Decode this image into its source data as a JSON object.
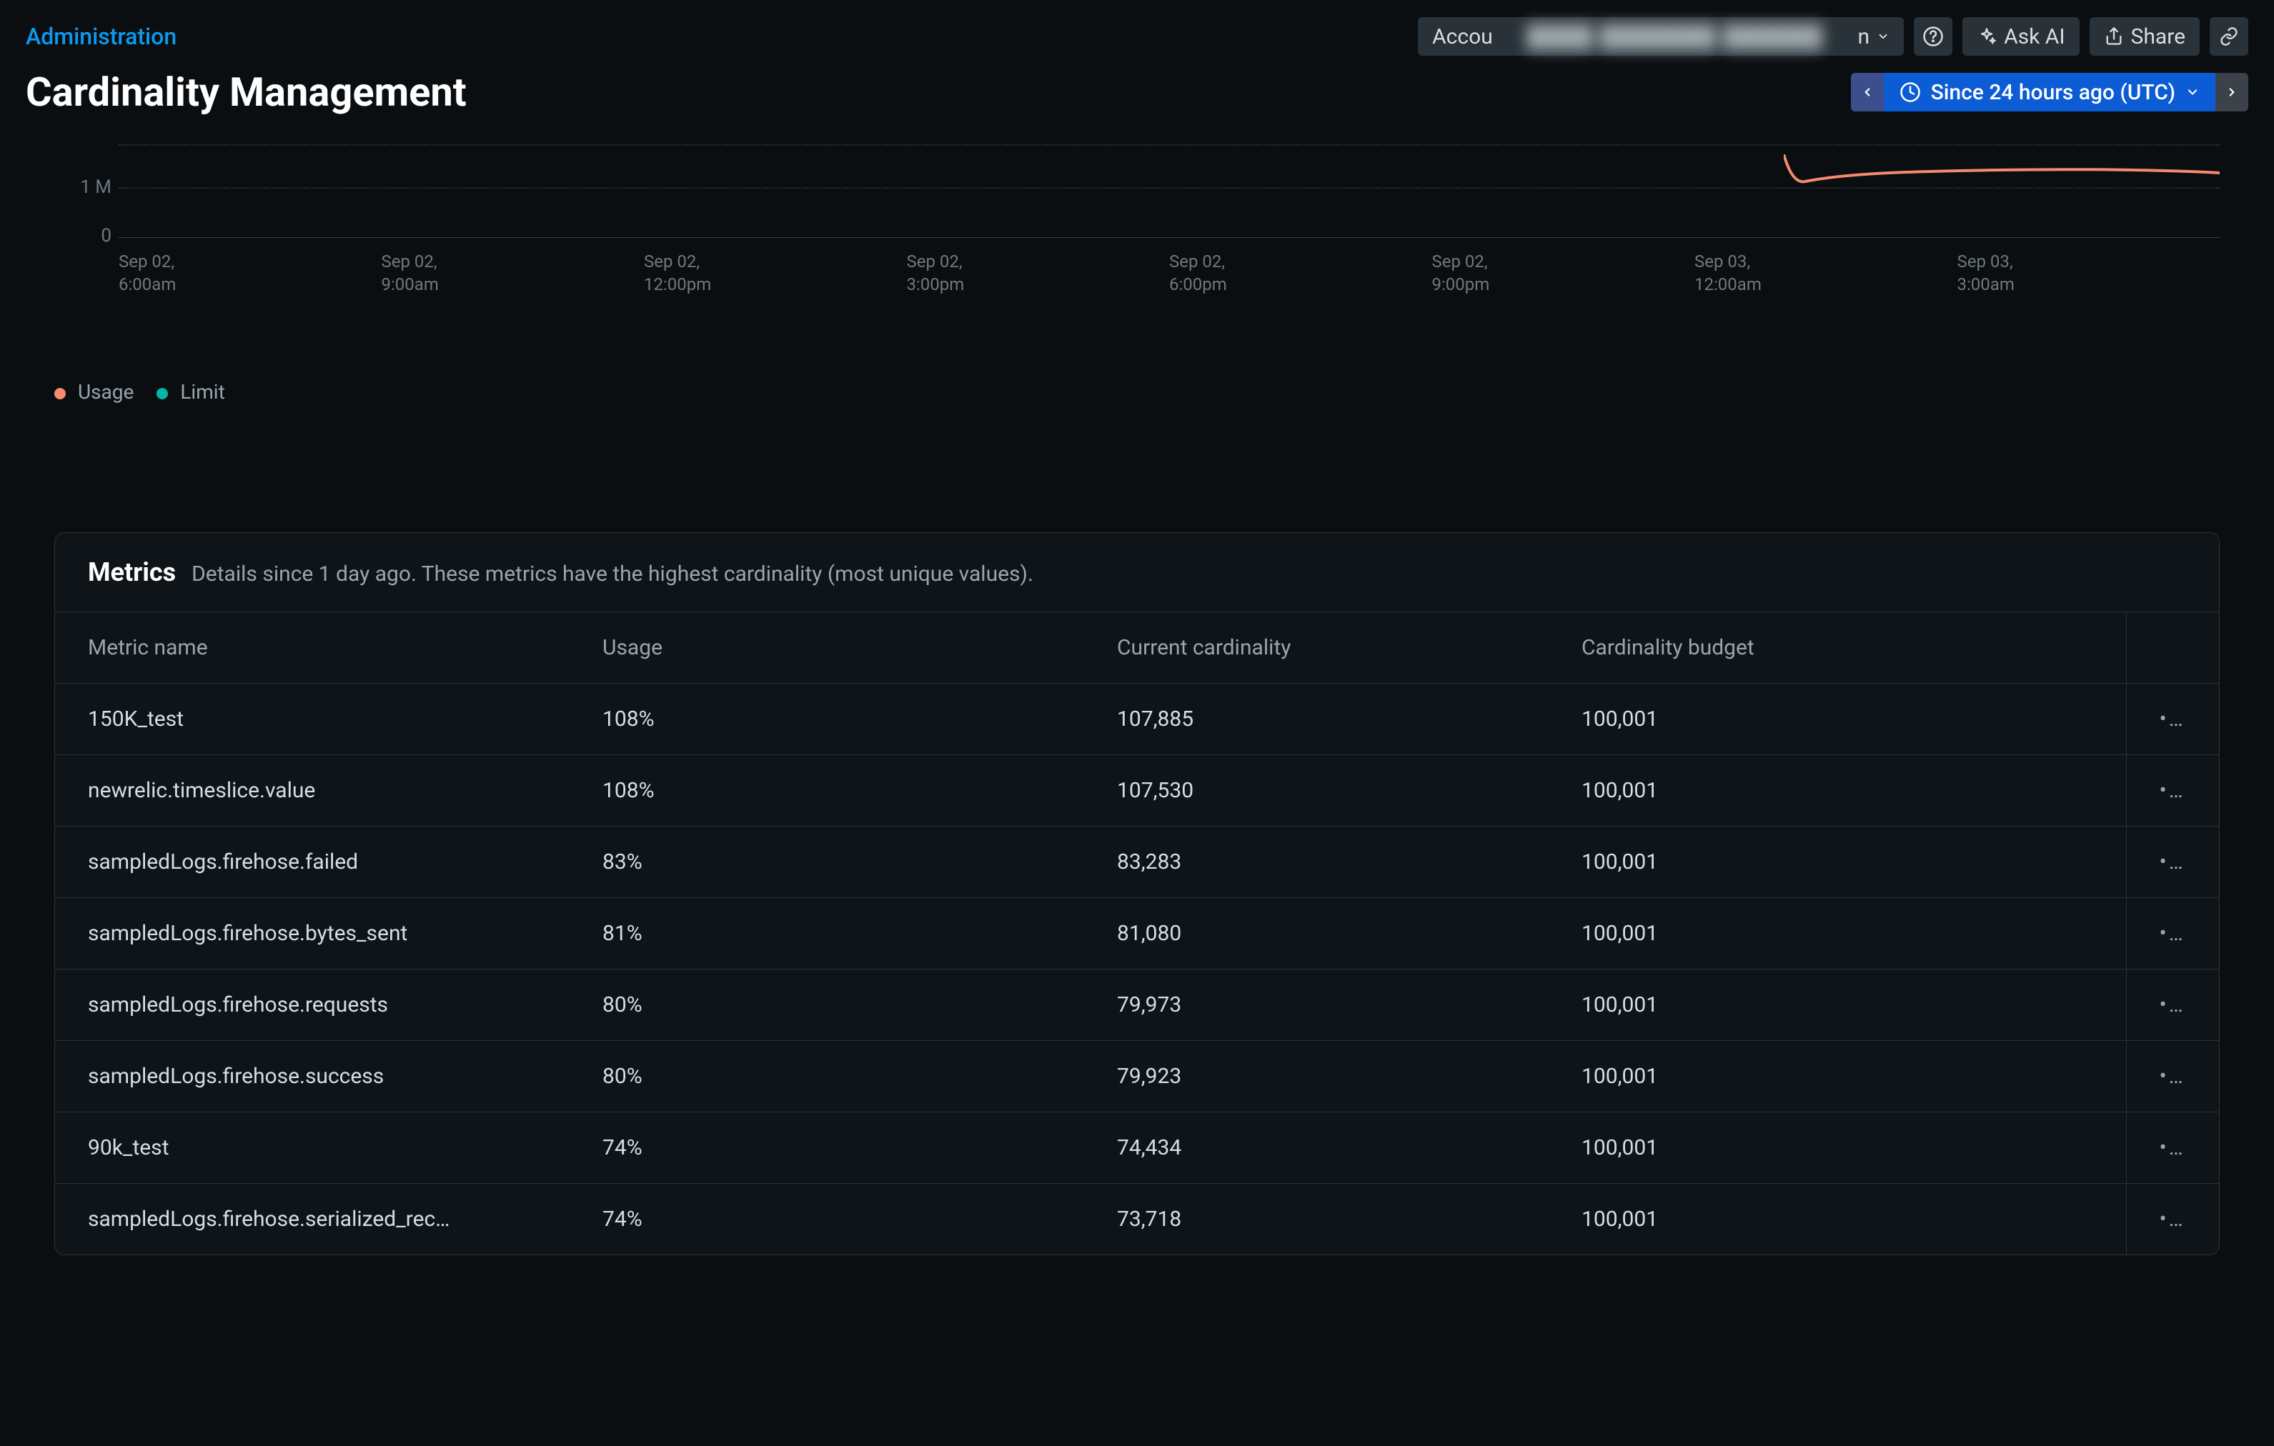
{
  "breadcrumb": "Administration",
  "page_title": "Cardinality Management",
  "header": {
    "account_prefix": "Accou",
    "account_blur": "n",
    "ask_ai": "Ask AI",
    "share": "Share"
  },
  "time_picker": {
    "label": "Since 24 hours ago (UTC)"
  },
  "chart_data": {
    "type": "line",
    "ylabels": [
      "1 M",
      "0"
    ],
    "xlabels": [
      "Sep 02,\n6:00am",
      "Sep 02,\n9:00am",
      "Sep 02,\n12:00pm",
      "Sep 02,\n3:00pm",
      "Sep 02,\n6:00pm",
      "Sep 02,\n9:00pm",
      "Sep 03,\n12:00am",
      "Sep 03,\n3:00am"
    ],
    "series": [
      {
        "name": "Usage",
        "color": "#f58a6e",
        "values_approx": [
          1700000,
          1500000,
          1540000,
          1560000,
          1570000,
          1570000,
          1560000
        ]
      }
    ],
    "ylim": [
      0,
      2000000
    ],
    "legend": [
      "Usage",
      "Limit"
    ]
  },
  "metrics_panel": {
    "title": "Metrics",
    "subtitle": "Details since 1 day ago. These metrics have the highest cardinality (most unique values).",
    "columns": [
      "Metric name",
      "Usage",
      "Current cardinality",
      "Cardinality budget"
    ],
    "rows": [
      {
        "name": "150K_test",
        "usage": "108%",
        "current": "107,885",
        "budget": "100,001"
      },
      {
        "name": "newrelic.timeslice.value",
        "usage": "108%",
        "current": "107,530",
        "budget": "100,001"
      },
      {
        "name": "sampledLogs.firehose.failed",
        "usage": "83%",
        "current": "83,283",
        "budget": "100,001"
      },
      {
        "name": "sampledLogs.firehose.bytes_sent",
        "usage": "81%",
        "current": "81,080",
        "budget": "100,001"
      },
      {
        "name": "sampledLogs.firehose.requests",
        "usage": "80%",
        "current": "79,973",
        "budget": "100,001"
      },
      {
        "name": "sampledLogs.firehose.success",
        "usage": "80%",
        "current": "79,923",
        "budget": "100,001"
      },
      {
        "name": "90k_test",
        "usage": "74%",
        "current": "74,434",
        "budget": "100,001"
      },
      {
        "name": "sampledLogs.firehose.serialized_rec…",
        "usage": "74%",
        "current": "73,718",
        "budget": "100,001"
      }
    ]
  }
}
